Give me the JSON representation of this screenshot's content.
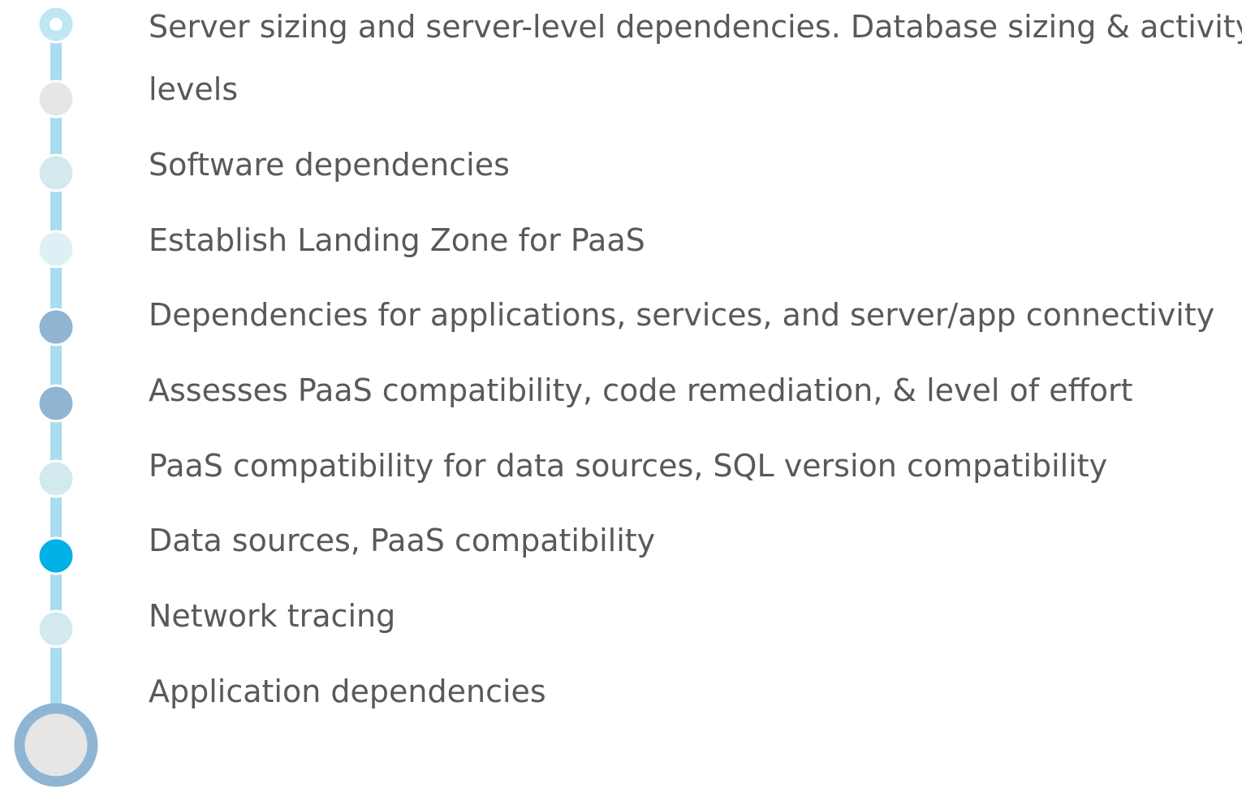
{
  "items": [
    {
      "line1": "Server sizing and server-level dependencies. Database sizing & activity",
      "line2": "levels",
      "color": "#bfe6f3"
    },
    {
      "line1": "Software dependencies",
      "color": "#e6e6e6"
    },
    {
      "line1": "Establish Landing Zone for PaaS",
      "color": "#d2e9ee"
    },
    {
      "line1": "Dependencies for applications, services, and server/app connectivity",
      "color": "#def0f6"
    },
    {
      "line1": "Assesses PaaS compatibility, code remediation, & level of effort",
      "color": "#8fb5d3"
    },
    {
      "line1": "PaaS compatibility for data sources, SQL version compatibility",
      "color": "#8fb5d3"
    },
    {
      "line1": "Data sources, PaaS compatibility",
      "color": "#d2e9ee"
    },
    {
      "line1": "Network tracing",
      "color": "#00b0e6"
    },
    {
      "line1": "Application dependencies",
      "color": "#d2e9ee"
    }
  ],
  "colors": {
    "line": "#a8dcee",
    "node_border": "#ffffff",
    "end_ring": "#8fb5d3",
    "end_fill": "#e6e6e6",
    "text": "#595959"
  }
}
